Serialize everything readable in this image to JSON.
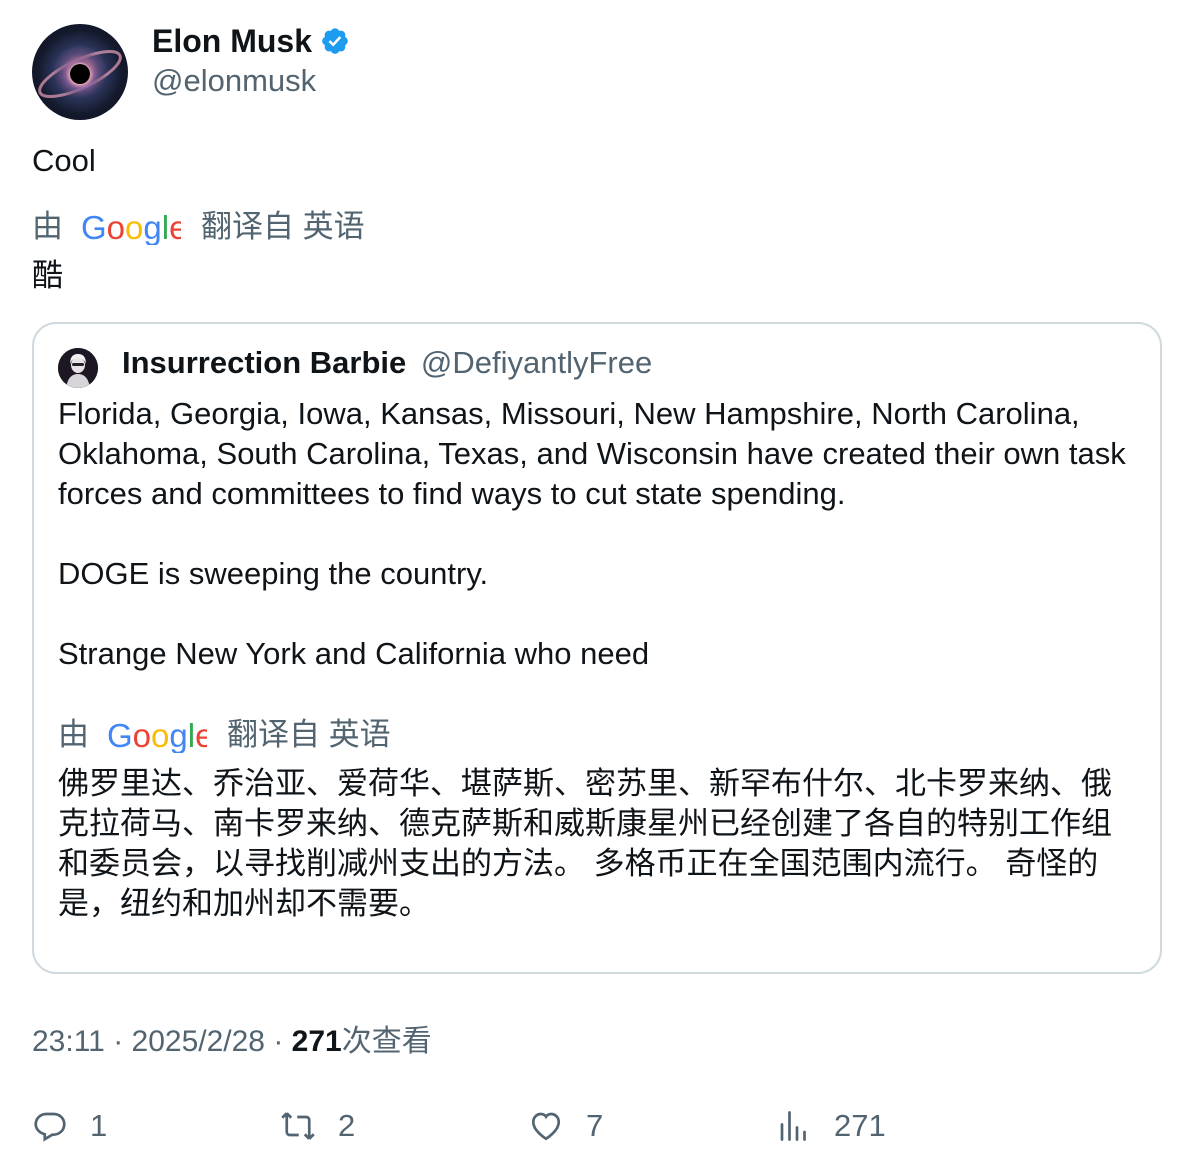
{
  "tweet": {
    "author_name": "Elon Musk",
    "author_handle": "@elonmusk",
    "verified_icon": "verified-badge-icon",
    "text": "Cool",
    "translation": {
      "by": "由",
      "provider": "Google",
      "from_label": "翻译自 英语",
      "text": "酷"
    }
  },
  "quote": {
    "author_name": "Insurrection Barbie",
    "author_handle": "@DefiyantlyFree",
    "paragraphs": [
      "Florida, Georgia, Iowa, Kansas, Missouri, New Hampshire, North Carolina, Oklahoma, South Carolina, Texas, and Wisconsin have created their own task forces and committees to find ways to cut state spending.",
      "DOGE is sweeping the country.",
      "Strange New York and California who need"
    ],
    "translation": {
      "by": "由",
      "provider": "Google",
      "from_label": "翻译自 英语",
      "text": "佛罗里达、乔治亚、爱荷华、堪萨斯、密苏里、新罕布什尔、北卡罗来纳、俄克拉荷马、南卡罗来纳、德克萨斯和威斯康星州已经创建了各自的特别工作组和委员会，以寻找削减州支出的方法。 多格币正在全国范围内流行。 奇怪的是，纽约和加州却不需要。"
    }
  },
  "meta": {
    "time": "23:11",
    "sep1": " · ",
    "date": "2025/2/28",
    "sep2": " · ",
    "views_count": "271",
    "views_label": "次查看"
  },
  "actions": {
    "reply_count": "1",
    "repost_count": "2",
    "like_count": "7",
    "views_count": "271"
  },
  "colors": {
    "text": "#0f1419",
    "secondary": "#536471",
    "border": "#cfd9de",
    "verified": "#1d9bf0"
  }
}
